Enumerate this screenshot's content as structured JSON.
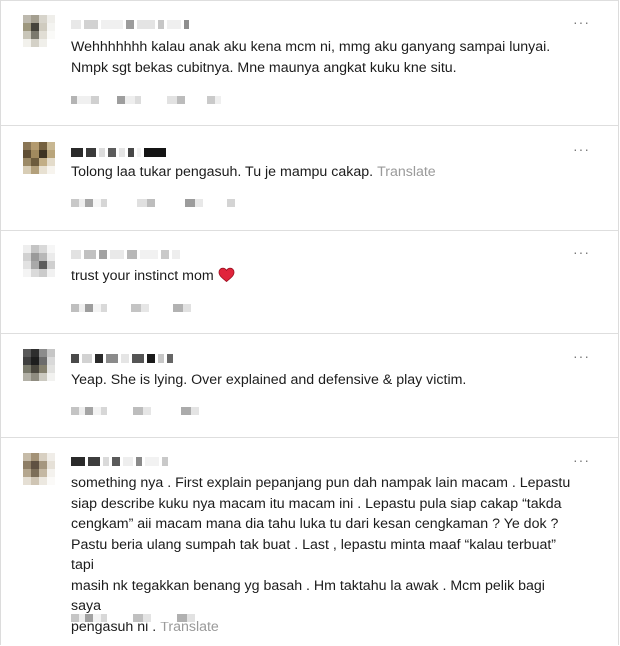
{
  "comments": [
    {
      "text": "Wehhhhhhh kalau anak aku kena mcm ni, mmg aku ganyang sampai lunyai.\nNmpk sgt bekas cubitnya. Mne maunya angkat kuku kne situ.",
      "translate": ""
    },
    {
      "text": "Tolong laa tukar pengasuh. Tu je mampu cakap.",
      "translate": "Translate"
    },
    {
      "text": "trust your instinct mom",
      "translate": "",
      "emoji": "heart-icon"
    },
    {
      "text": "Yeap. She is lying. Over explained and defensive & play victim.",
      "translate": ""
    },
    {
      "text": "something nya . First explain pepanjang pun dah nampak lain macam . Lepastu\nsiap describe kuku nya macam itu macam ini . Lepastu pula siap cakap “takda\ncengkam” aii macam mana dia tahu luka tu dari kesan cengkaman ? Ye dok ?\nPastu beria ulang sumpah tak buat . Last , lepastu minta maaf “kalau terbuat” tapi\nmasih nk tegakkan benang yg basah . Hm taktahu la awak . Mcm pelik bagi saya\npengasuh ni .",
      "translate": "Translate"
    }
  ],
  "more_glyph": "···",
  "colors": {
    "text": "#1c1c1c",
    "muted": "#9a9a9a",
    "divider": "#dedede",
    "heart": "#e0243b"
  }
}
